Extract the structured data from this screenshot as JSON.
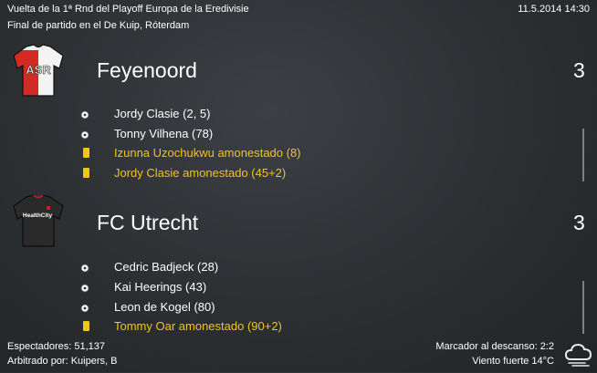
{
  "header": {
    "competition": "Vuelta de la 1ª Rnd del Playoff Europa de la Eredivisie",
    "subtitle": "Final de partido en el De Kuip, Róterdam",
    "datetime": "11.5.2014 14:30"
  },
  "home": {
    "name": "Feyenoord",
    "score": "3",
    "shirt_text": "ASR",
    "events": [
      {
        "type": "goal",
        "text": "Jordy Clasie (2, 5)"
      },
      {
        "type": "goal",
        "text": "Tonny Vilhena (78)"
      },
      {
        "type": "card",
        "text": "Izunna Uzochukwu amonestado (8)"
      },
      {
        "type": "card",
        "text": "Jordy Clasie amonestado (45+2)"
      }
    ]
  },
  "away": {
    "name": "FC Utrecht",
    "score": "3",
    "shirt_text": "HealthCity",
    "events": [
      {
        "type": "goal",
        "text": "Cedric Badjeck (28)"
      },
      {
        "type": "goal",
        "text": "Kai Heerings (43)"
      },
      {
        "type": "goal",
        "text": "Leon de Kogel (80)"
      },
      {
        "type": "card",
        "text": "Tommy Oar amonestado (90+2)"
      }
    ]
  },
  "footer": {
    "attendance": "Espectadores: 51,137",
    "referee": "Arbitrado por: Kuipers, B",
    "halftime": "Marcador al descanso: 2:2",
    "weather": "Viento fuerte 14°C",
    "weather_icon": "cloud-wind-icon"
  },
  "colors": {
    "card_text": "#f0c518",
    "yellow_card": "#f2c60f",
    "home_red": "#d42a24"
  }
}
